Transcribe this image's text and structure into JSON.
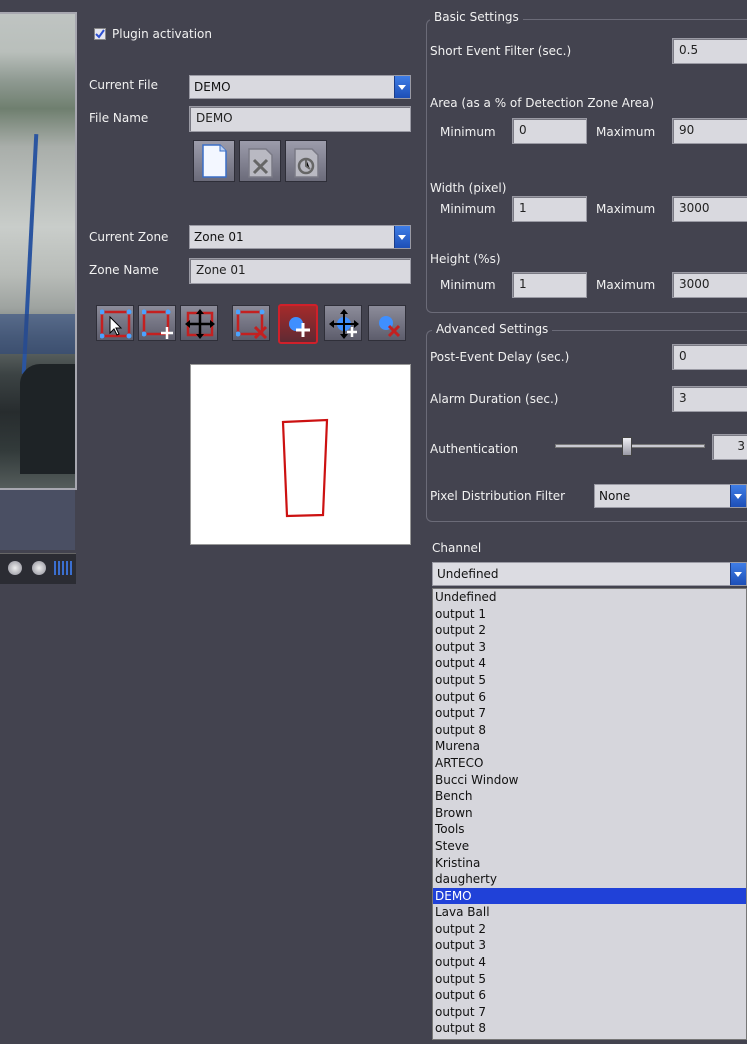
{
  "left": {
    "plugin_activation_label": "Plugin activation",
    "plugin_activation_checked": true,
    "current_file_label": "Current File",
    "current_file_value": "DEMO",
    "file_name_label": "File Name",
    "file_name_value": "DEMO",
    "current_zone_label": "Current Zone",
    "current_zone_value": "Zone 01",
    "zone_name_label": "Zone Name",
    "zone_name_value": "Zone 01"
  },
  "file_buttons": [
    "new-file-icon",
    "delete-file-icon",
    "save-file-icon"
  ],
  "zone_tools": [
    "select-arrow-icon",
    "add-zone-icon",
    "move-icon",
    "delete-zone-icon",
    "add-point-icon",
    "move-point-icon",
    "remove-point-icon"
  ],
  "basic": {
    "legend": "Basic Settings",
    "short_event_label": "Short Event Filter (sec.)",
    "short_event_value": "0.5",
    "area_label": "Area (as a % of Detection Zone Area)",
    "area_min_label": "Minimum",
    "area_min_value": "0",
    "area_max_label": "Maximum",
    "area_max_value": "90",
    "width_label": "Width (pixel)",
    "width_min_label": "Minimum",
    "width_min_value": "1",
    "width_max_label": "Maximum",
    "width_max_value": "3000",
    "height_label": "Height (%s)",
    "height_min_label": "Minimum",
    "height_min_value": "1",
    "height_max_label": "Maximum",
    "height_max_value": "3000"
  },
  "advanced": {
    "legend": "Advanced Settings",
    "post_event_label": "Post-Event Delay (sec.)",
    "post_event_value": "0",
    "alarm_label": "Alarm Duration (sec.)",
    "alarm_value": "3",
    "auth_label": "Authentication",
    "auth_value": "3",
    "pixel_filter_label": "Pixel Distribution Filter",
    "pixel_filter_value": "None"
  },
  "channel": {
    "label": "Channel",
    "selected": "Undefined",
    "options": [
      "Undefined",
      "output 1",
      "output 2",
      "output 3",
      "output 4",
      "output 5",
      "output 6",
      "output 7",
      "output 8",
      "Murena",
      "ARTECO",
      "Bucci Window",
      "Bench",
      "Brown",
      "Tools",
      "Steve",
      "Kristina",
      "daugherty",
      "DEMO",
      "Lava Ball",
      "output 2",
      "output 3",
      "output 4",
      "output 5",
      "output 6",
      "output 7",
      "output 8"
    ],
    "highlighted": "DEMO"
  },
  "colors": {
    "background": "#43434f",
    "accent": "#2041d8",
    "zone_outline": "#cc1111"
  }
}
